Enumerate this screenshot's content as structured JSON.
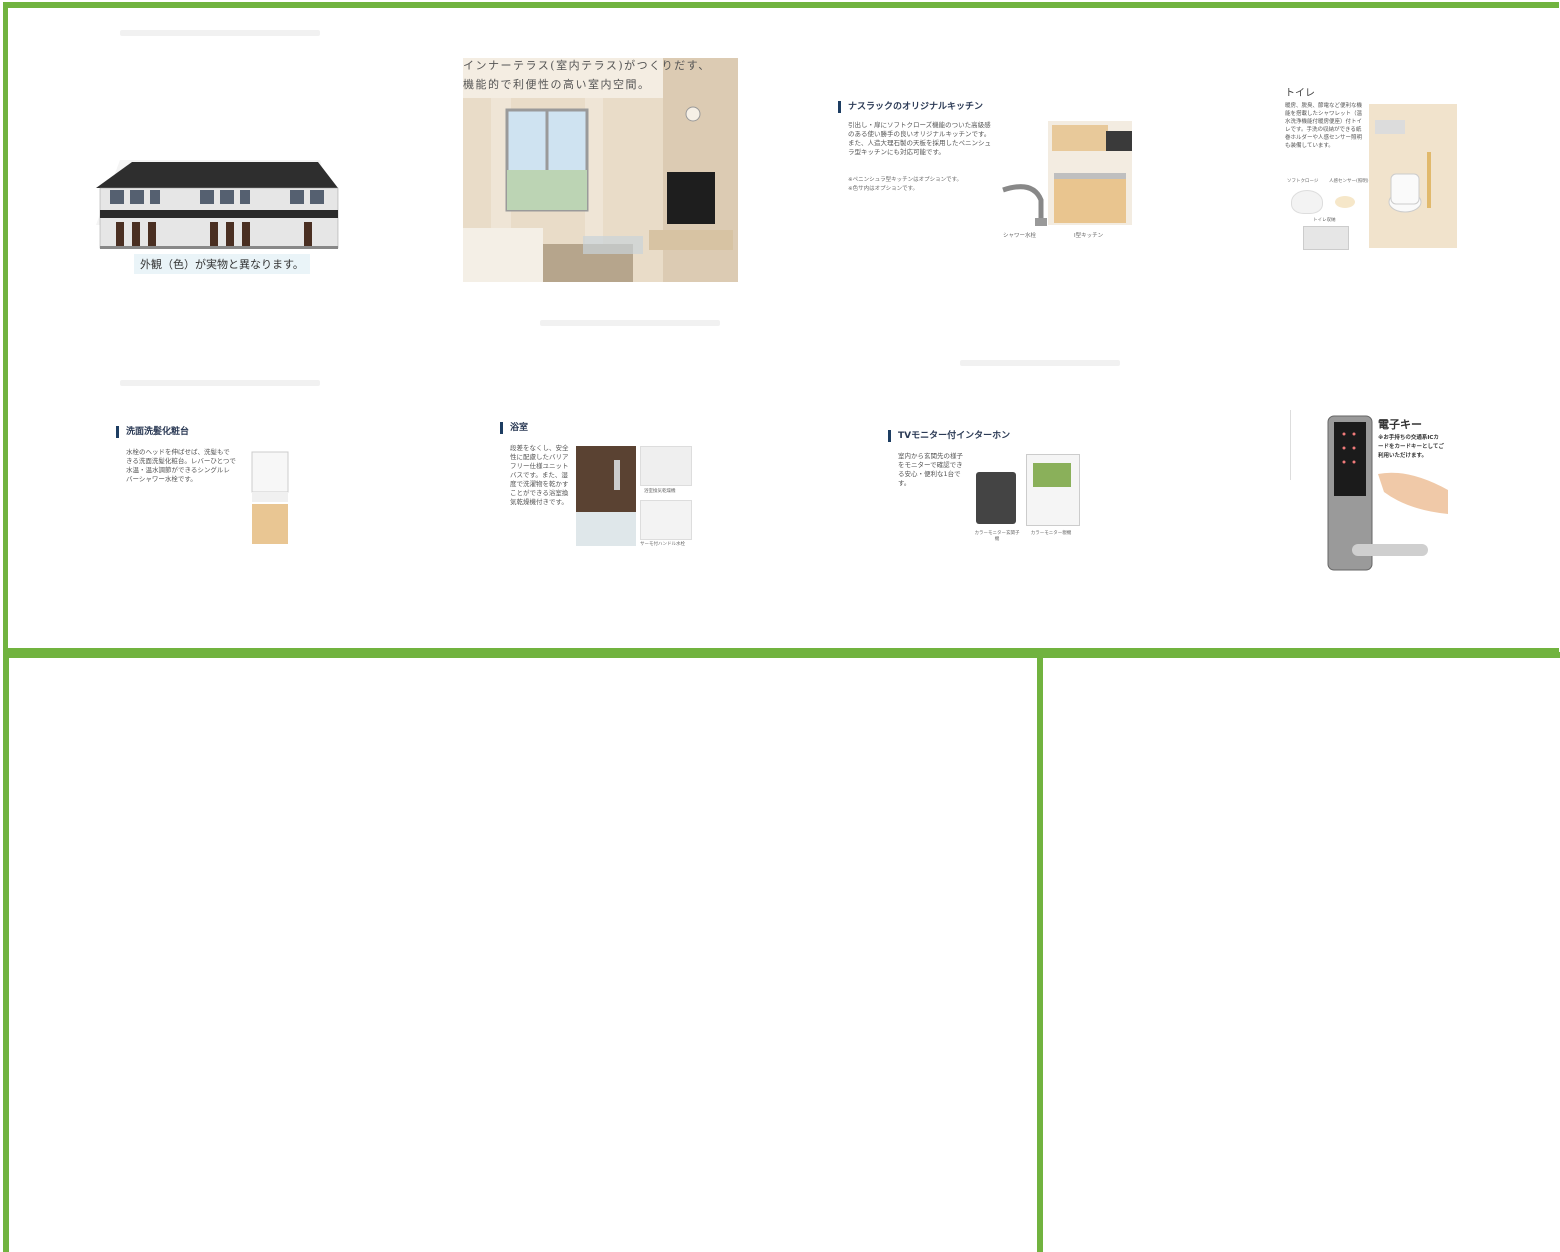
{
  "tiles": {
    "exterior": {
      "caption": "外観（色）が実物と異なります。"
    },
    "interior": {
      "line1": "インナーテラス(室内テラス)がつくりだす、",
      "line2": "機能的で利便性の高い室内空間。"
    },
    "kitchen": {
      "title": "ナスラックのオリジナルキッチン",
      "body": "引出し・扉にソフトクローズ機能のついた高級感のある使い勝手の良いオリジナルキッチンです。また、人造大理石製の天板を採用したペニンシュラ型キッチンにも対応可能です。",
      "note1": "※ペニンシュラ型キッチンはオプションです。",
      "note2": "※色サ内はオプションです。",
      "label_faucet": "シャワー水栓",
      "label_kitchen": "I型キッチン"
    },
    "toilet": {
      "title": "トイレ",
      "body": "暖房、脱臭、節電など便利な機能を搭載したシャワレット（温水洗浄機能付暖房便座）付トイレです。手洗の収納ができる紙巻ホルダーや人感センサー照明も装備しています。",
      "label1": "ソフトクロージ",
      "label2": "人感センサー(照明)",
      "label3": "トイレ収納"
    },
    "washbasin": {
      "title": "洗面洗髪化粧台",
      "body": "水栓のヘッドを伸ばせば、洗髪もできる洗面洗髪化粧台。レバーひとつで水温・温水調節ができるシングルレバーシャワー水栓です。"
    },
    "bath": {
      "title": "浴室",
      "body": "段差をなくし、安全性に配慮したバリアフリー仕様ユニットバスです。また、湿度で洗濯物を乾かすことができる浴室換気乾燥機付きです。",
      "label1": "浴室換気乾燥機",
      "label2": "サーモ付ハンドル水栓"
    },
    "intercom": {
      "title": "TVモニター付インターホン",
      "body": "室内から玄関先の様子をモニターで確認できる安心・便利な1台です。",
      "label1": "カラーモニター玄関子機",
      "label2": "カラーモニター親機"
    },
    "ekey": {
      "title": "電子キー",
      "body": "※お手持ちの交通系ICカードをカードキーとしてご利用いただけます。"
    }
  },
  "colors": {
    "frame": "#71b33f",
    "accent": "#1d3d62"
  }
}
